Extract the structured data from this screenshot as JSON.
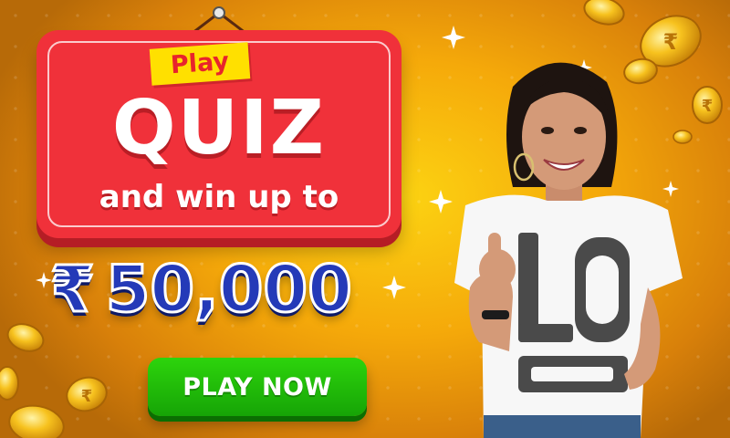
{
  "banner": {
    "tag_text": "Play",
    "headline": "QUIZ",
    "subheadline": "and win up to",
    "prize_currency": "₹",
    "prize_amount": "50,000",
    "cta_label": "PLAY NOW"
  },
  "colors": {
    "background": "#f5b60a",
    "sign_red": "#f0313a",
    "tag_yellow": "#ffe000",
    "prize_blue": "#243ab8",
    "cta_green": "#1fbf08"
  },
  "icons": {
    "coin": "gold-rupee-coin-icon",
    "sparkle": "sparkle-icon"
  }
}
